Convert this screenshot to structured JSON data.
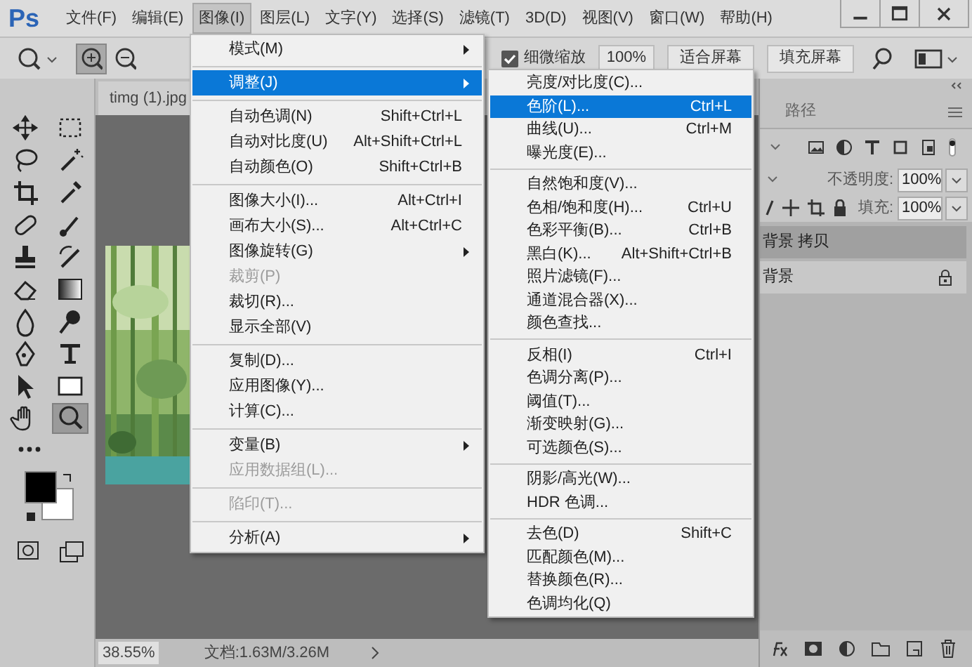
{
  "app_logo": "Ps",
  "menubar": [
    {
      "label": "文件(F)",
      "selected": false
    },
    {
      "label": "编辑(E)",
      "selected": false
    },
    {
      "label": "图像(I)",
      "selected": true
    },
    {
      "label": "图层(L)",
      "selected": false
    },
    {
      "label": "文字(Y)",
      "selected": false
    },
    {
      "label": "选择(S)",
      "selected": false
    },
    {
      "label": "滤镜(T)",
      "selected": false
    },
    {
      "label": "3D(D)",
      "selected": false
    },
    {
      "label": "视图(V)",
      "selected": false
    },
    {
      "label": "窗口(W)",
      "selected": false
    },
    {
      "label": "帮助(H)",
      "selected": false
    }
  ],
  "options_bar": {
    "zoom_buttons": [
      {
        "selected": true
      },
      {
        "selected": false
      }
    ],
    "fine_zoom": {
      "label": "细微缩放",
      "checked": true
    },
    "buttons": [
      "100%",
      "适合屏幕",
      "填充屏幕"
    ]
  },
  "document_tab": "timg (1).jpg",
  "tools": [
    {
      "selected": false
    },
    {
      "selected": false
    },
    {
      "selected": false
    },
    {
      "selected": false
    },
    {
      "selected": false
    },
    {
      "selected": false
    },
    {
      "selected": false
    },
    {
      "selected": false
    },
    {
      "selected": false
    },
    {
      "selected": false
    },
    {
      "selected": false
    },
    {
      "selected": false
    },
    {
      "selected": false
    },
    {
      "selected": false
    },
    {
      "selected": false
    },
    {
      "selected": false
    },
    {
      "selected": false
    },
    {
      "selected": false
    },
    {
      "selected": false
    },
    {
      "selected": true
    }
  ],
  "status_bar": {
    "zoom": "38.55%",
    "document_size": "文档:1.63M/3.26M"
  },
  "image_menu": {
    "groups": [
      [
        {
          "label": "模式(M)",
          "submenu": true,
          "disabled": false,
          "selected": false
        }
      ],
      [
        {
          "label": "调整(J)",
          "submenu": true,
          "disabled": false,
          "selected": true
        }
      ],
      [
        {
          "label": "自动色调(N)",
          "shortcut": "Shift+Ctrl+L",
          "submenu": false,
          "disabled": false,
          "selected": false
        },
        {
          "label": "自动对比度(U)",
          "shortcut": "Alt+Shift+Ctrl+L",
          "submenu": false,
          "disabled": false,
          "selected": false
        },
        {
          "label": "自动颜色(O)",
          "shortcut": "Shift+Ctrl+B",
          "submenu": false,
          "disabled": false,
          "selected": false
        }
      ],
      [
        {
          "label": "图像大小(I)...",
          "shortcut": "Alt+Ctrl+I",
          "submenu": false,
          "disabled": false,
          "selected": false
        },
        {
          "label": "画布大小(S)...",
          "shortcut": "Alt+Ctrl+C",
          "submenu": false,
          "disabled": false,
          "selected": false
        },
        {
          "label": "图像旋转(G)",
          "submenu": true,
          "disabled": false,
          "selected": false
        },
        {
          "label": "裁剪(P)",
          "submenu": false,
          "disabled": true,
          "selected": false
        },
        {
          "label": "裁切(R)...",
          "submenu": false,
          "disabled": false,
          "selected": false
        },
        {
          "label": "显示全部(V)",
          "submenu": false,
          "disabled": false,
          "selected": false
        }
      ],
      [
        {
          "label": "复制(D)...",
          "submenu": false,
          "disabled": false,
          "selected": false
        },
        {
          "label": "应用图像(Y)...",
          "submenu": false,
          "disabled": false,
          "selected": false
        },
        {
          "label": "计算(C)...",
          "submenu": false,
          "disabled": false,
          "selected": false
        }
      ],
      [
        {
          "label": "变量(B)",
          "submenu": true,
          "disabled": false,
          "selected": false
        },
        {
          "label": "应用数据组(L)...",
          "submenu": false,
          "disabled": true,
          "selected": false
        }
      ],
      [
        {
          "label": "陷印(T)...",
          "submenu": false,
          "disabled": true,
          "selected": false
        }
      ],
      [
        {
          "label": "分析(A)",
          "submenu": true,
          "disabled": false,
          "selected": false
        }
      ]
    ]
  },
  "adjustments_submenu": {
    "groups": [
      [
        {
          "label": "亮度/对比度(C)...",
          "selected": false
        },
        {
          "label": "色阶(L)...",
          "shortcut": "Ctrl+L",
          "selected": true
        },
        {
          "label": "曲线(U)...",
          "shortcut": "Ctrl+M",
          "selected": false
        },
        {
          "label": "曝光度(E)...",
          "selected": false
        }
      ],
      [
        {
          "label": "自然饱和度(V)...",
          "selected": false
        },
        {
          "label": "色相/饱和度(H)...",
          "shortcut": "Ctrl+U",
          "selected": false
        },
        {
          "label": "色彩平衡(B)...",
          "shortcut": "Ctrl+B",
          "selected": false
        },
        {
          "label": "黑白(K)...",
          "shortcut": "Alt+Shift+Ctrl+B",
          "selected": false
        },
        {
          "label": "照片滤镜(F)...",
          "selected": false
        },
        {
          "label": "通道混合器(X)...",
          "selected": false
        },
        {
          "label": "颜色查找...",
          "selected": false
        }
      ],
      [
        {
          "label": "反相(I)",
          "shortcut": "Ctrl+I",
          "selected": false
        },
        {
          "label": "色调分离(P)...",
          "selected": false
        },
        {
          "label": "阈值(T)...",
          "selected": false
        },
        {
          "label": "渐变映射(G)...",
          "selected": false
        },
        {
          "label": "可选颜色(S)...",
          "selected": false
        }
      ],
      [
        {
          "label": "阴影/高光(W)...",
          "selected": false
        },
        {
          "label": "HDR 色调...",
          "selected": false
        }
      ],
      [
        {
          "label": "去色(D)",
          "shortcut": "Shift+C",
          "selected": false
        },
        {
          "label": "匹配颜色(M)...",
          "selected": false
        },
        {
          "label": "替换颜色(R)...",
          "selected": false
        },
        {
          "label": "色调均化(Q)",
          "selected": false
        }
      ]
    ]
  },
  "layers_panel": {
    "tabs": [
      {
        "label": "路径"
      }
    ],
    "opacity": {
      "label": "不透明度:",
      "value": "100%"
    },
    "fill": {
      "label": "填充:",
      "value": "100%"
    },
    "layers": [
      {
        "name": "背景 拷贝",
        "selected": true,
        "locked": false
      },
      {
        "name": "背景",
        "selected": false,
        "locked": true
      }
    ]
  }
}
